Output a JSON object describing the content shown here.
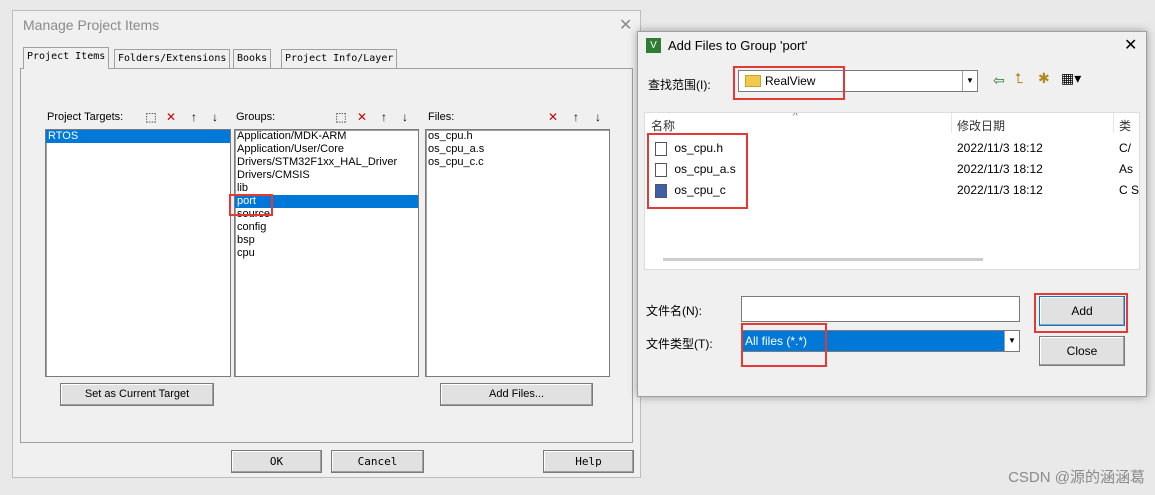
{
  "manage": {
    "title": "Manage Project Items",
    "tabs": [
      "Project Items",
      "Folders/Extensions",
      "Books",
      "Project Info/Layer"
    ],
    "targets_label": "Project Targets:",
    "groups_label": "Groups:",
    "files_label": "Files:",
    "targets": [
      "RTOS"
    ],
    "groups": [
      "Application/MDK-ARM",
      "Application/User/Core",
      "Drivers/STM32F1xx_HAL_Driver",
      "Drivers/CMSIS",
      "lib",
      "port",
      "source",
      "config",
      "bsp",
      "cpu"
    ],
    "files": [
      "os_cpu.h",
      "os_cpu_a.s",
      "os_cpu_c.c"
    ],
    "set_target_btn": "Set as Current Target",
    "add_files_btn": "Add Files...",
    "ok_btn": "OK",
    "cancel_btn": "Cancel",
    "help_btn": "Help"
  },
  "addfiles": {
    "title": "Add Files to Group 'port'",
    "lookin_label": "查找范围(I):",
    "lookin_value": "RealView",
    "col_name": "名称",
    "col_date": "修改日期",
    "col_type": "类",
    "files": [
      {
        "name": "os_cpu.h",
        "date": "2022/11/3 18:12",
        "type": "C/"
      },
      {
        "name": "os_cpu_a.s",
        "date": "2022/11/3 18:12",
        "type": "As"
      },
      {
        "name": "os_cpu_c",
        "date": "2022/11/3 18:12",
        "type": "C S"
      }
    ],
    "filename_label": "文件名(N):",
    "filename_value": "",
    "filetype_label": "文件类型(T):",
    "filetype_value": "All files (*.*)",
    "add_btn": "Add",
    "close_btn": "Close"
  },
  "watermark": "CSDN @源的涵涵葛",
  "colors": {
    "selection": "#0078d7",
    "highlight": "#e53935"
  }
}
